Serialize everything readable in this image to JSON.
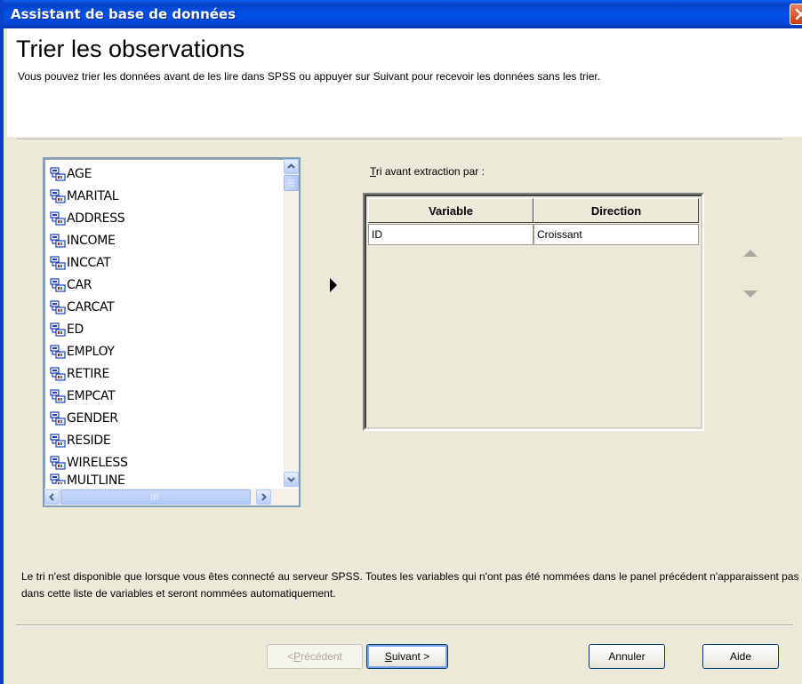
{
  "window": {
    "title": "Assistant de base de données"
  },
  "header": {
    "title": "Trier les observations",
    "description": "Vous pouvez trier les données avant de les lire dans SPSS ou appuyer sur Suivant pour recevoir les données sans les trier."
  },
  "variables": {
    "items": [
      {
        "label": "AGE"
      },
      {
        "label": "MARITAL"
      },
      {
        "label": "ADDRESS"
      },
      {
        "label": "INCOME"
      },
      {
        "label": "INCCAT"
      },
      {
        "label": "CAR"
      },
      {
        "label": "CARCAT"
      },
      {
        "label": "ED"
      },
      {
        "label": "EMPLOY"
      },
      {
        "label": "RETIRE"
      },
      {
        "label": "EMPCAT"
      },
      {
        "label": "GENDER"
      },
      {
        "label": "RESIDE"
      },
      {
        "label": "WIRELESS"
      },
      {
        "label": "MULTLINE"
      }
    ]
  },
  "sort": {
    "label_mnemonic": "T",
    "label_rest": "ri avant extraction par :",
    "columns": [
      "Variable",
      "Direction"
    ],
    "rows": [
      {
        "variable": "ID",
        "direction": "Croissant"
      }
    ]
  },
  "footer": {
    "note": "Le tri n'est disponible que lorsque vous êtes connecté au serveur SPSS. Toutes les variables qui n'ont pas été nommées dans le panel précédent n'apparaissent pas dans cette liste de variables et seront nommées automatiquement."
  },
  "buttons": {
    "back": {
      "prefix": "< ",
      "mnemonic": "P",
      "rest": "récédent"
    },
    "next": {
      "mnemonic": "S",
      "rest": "uivant >"
    },
    "cancel": "Annuler",
    "help": "Aide"
  },
  "colors": {
    "titlebar": "#0842C8",
    "dialog_bg": "#ECE9D8",
    "scroll_accent": "#B7CDF7"
  }
}
